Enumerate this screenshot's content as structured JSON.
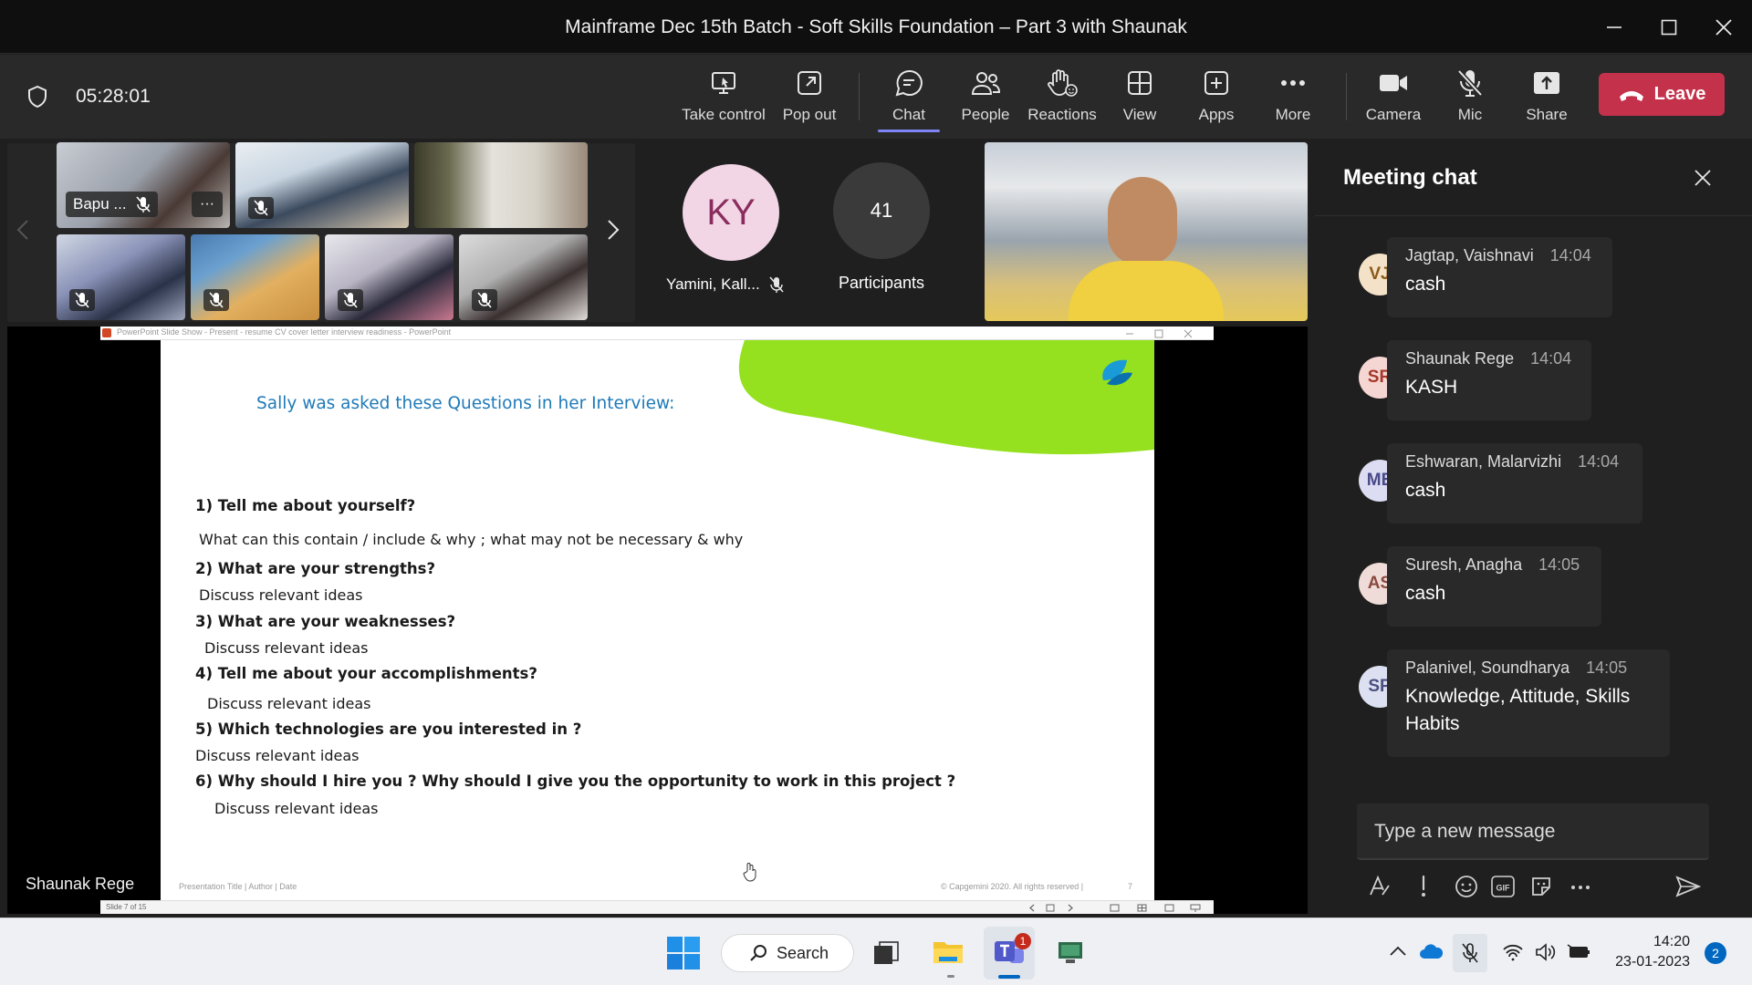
{
  "window": {
    "title": "Mainframe Dec 15th Batch - Soft Skills Foundation – Part 3 with  Shaunak"
  },
  "toolbar": {
    "timer": "05:28:01",
    "take_control": "Take control",
    "pop_out": "Pop out",
    "chat": "Chat",
    "people": "People",
    "reactions": "Reactions",
    "view": "View",
    "apps": "Apps",
    "more": "More",
    "camera": "Camera",
    "mic": "Mic",
    "share": "Share",
    "leave": "Leave"
  },
  "gallery": {
    "first_name": "Bapu ...",
    "more_dots": "···",
    "ky_initials": "KY",
    "ky_name": "Yamini, Kall...",
    "participants_count": "41",
    "participants_label": "Participants"
  },
  "slide": {
    "window_title": "PowerPoint Slide Show  -  Present  -  resume CV cover letter interview readiness - PowerPoint",
    "heading": "Sally was asked these Questions in her Interview:",
    "questions": [
      {
        "q": "1) Tell me about yourself?",
        "d": "What can this contain / include & why ; what may not be necessary & why"
      },
      {
        "q": "2) What are your  strengths?",
        "d": "Discuss relevant ideas"
      },
      {
        "q": "3) What are your weaknesses?",
        "d": "Discuss relevant ideas"
      },
      {
        "q": "4) Tell me about your accomplishments?",
        "d": "Discuss relevant ideas"
      },
      {
        "q": "5) Which technologies are you interested in ?",
        "d": "Discuss relevant ideas"
      },
      {
        "q": "6) Why should I hire you ? Why should I give you the opportunity to work in this project ?",
        "d": "Discuss relevant ideas"
      }
    ],
    "footer_left": "Presentation Title | Author | Date",
    "footer_right": "© Capgemini 2020. All rights reserved  |",
    "page_num": "7",
    "status_text": "Slide 7 of 15",
    "presenter": "Shaunak Rege",
    "colors": {
      "heading": "#1f7ab8",
      "swoosh": "#95e11f",
      "logo": "#1a9bd8"
    }
  },
  "chat": {
    "title": "Meeting chat",
    "messages": [
      {
        "initials": "VJ",
        "name": "Jagtap, Vaishnavi",
        "time": "14:04",
        "body": "cash",
        "avatar_bg": "#f3e1c8",
        "avatar_fg": "#8a5a1a"
      },
      {
        "initials": "SR",
        "name": "Shaunak Rege",
        "time": "14:04",
        "body": "KASH",
        "avatar_bg": "#f6d6d2",
        "avatar_fg": "#a4382a"
      },
      {
        "initials": "ME",
        "name": "Eshwaran, Malarvizhi",
        "time": "14:04",
        "body": "cash",
        "avatar_bg": "#dcdcf2",
        "avatar_fg": "#4a4a8a"
      },
      {
        "initials": "AS",
        "name": "Suresh, Anagha",
        "time": "14:05",
        "body": "cash",
        "avatar_bg": "#efdcd8",
        "avatar_fg": "#8a4a3e"
      },
      {
        "initials": "SP",
        "name": "Palanivel, Soundharya",
        "time": "14:05",
        "body": "Knowledge, Attitude, Skills Habits",
        "avatar_bg": "#dde0f0",
        "avatar_fg": "#4a5080"
      }
    ],
    "compose_placeholder": "Type a new message"
  },
  "taskbar": {
    "search": "Search",
    "teams_badge": "1",
    "time": "14:20",
    "date": "23-01-2023",
    "notification_count": "2"
  }
}
